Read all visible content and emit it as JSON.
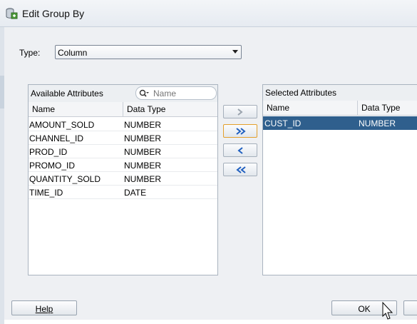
{
  "window": {
    "title": "Edit Group By",
    "icon": "database-icon"
  },
  "type_field": {
    "label": "Type:",
    "value": "Column"
  },
  "available": {
    "title": "Available Attributes",
    "search_placeholder": "Name",
    "columns": [
      "Name",
      "Data Type"
    ],
    "rows": [
      {
        "name": "AMOUNT_SOLD",
        "type": "NUMBER"
      },
      {
        "name": "CHANNEL_ID",
        "type": "NUMBER"
      },
      {
        "name": "PROD_ID",
        "type": "NUMBER"
      },
      {
        "name": "PROMO_ID",
        "type": "NUMBER"
      },
      {
        "name": "QUANTITY_SOLD",
        "type": "NUMBER"
      },
      {
        "name": "TIME_ID",
        "type": "DATE"
      }
    ]
  },
  "selected": {
    "title": "Selected Attributes",
    "columns": [
      "Name",
      "Data Type"
    ],
    "rows": [
      {
        "name": "CUST_ID",
        "type": "NUMBER",
        "selected": true
      }
    ]
  },
  "move_buttons": [
    {
      "icon": "move-right-icon",
      "enabled": false
    },
    {
      "icon": "move-all-right-icon",
      "enabled": true,
      "focused": true
    },
    {
      "icon": "move-left-icon",
      "enabled": true
    },
    {
      "icon": "move-all-left-icon",
      "enabled": true
    }
  ],
  "buttons": {
    "help": "Help",
    "ok": "OK"
  },
  "colors": {
    "selection": "#2f5f8d",
    "focus": "#e3a02b",
    "arrow": "#1f5fbf"
  }
}
